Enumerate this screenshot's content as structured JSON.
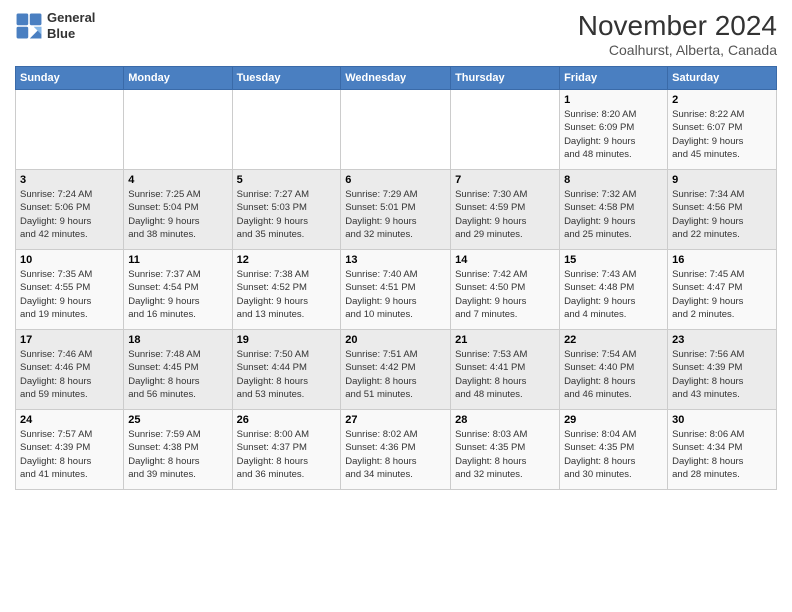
{
  "logo": {
    "line1": "General",
    "line2": "Blue"
  },
  "title": "November 2024",
  "subtitle": "Coalhurst, Alberta, Canada",
  "days_of_week": [
    "Sunday",
    "Monday",
    "Tuesday",
    "Wednesday",
    "Thursday",
    "Friday",
    "Saturday"
  ],
  "weeks": [
    [
      {
        "day": "",
        "info": ""
      },
      {
        "day": "",
        "info": ""
      },
      {
        "day": "",
        "info": ""
      },
      {
        "day": "",
        "info": ""
      },
      {
        "day": "",
        "info": ""
      },
      {
        "day": "1",
        "info": "Sunrise: 8:20 AM\nSunset: 6:09 PM\nDaylight: 9 hours\nand 48 minutes."
      },
      {
        "day": "2",
        "info": "Sunrise: 8:22 AM\nSunset: 6:07 PM\nDaylight: 9 hours\nand 45 minutes."
      }
    ],
    [
      {
        "day": "3",
        "info": "Sunrise: 7:24 AM\nSunset: 5:06 PM\nDaylight: 9 hours\nand 42 minutes."
      },
      {
        "day": "4",
        "info": "Sunrise: 7:25 AM\nSunset: 5:04 PM\nDaylight: 9 hours\nand 38 minutes."
      },
      {
        "day": "5",
        "info": "Sunrise: 7:27 AM\nSunset: 5:03 PM\nDaylight: 9 hours\nand 35 minutes."
      },
      {
        "day": "6",
        "info": "Sunrise: 7:29 AM\nSunset: 5:01 PM\nDaylight: 9 hours\nand 32 minutes."
      },
      {
        "day": "7",
        "info": "Sunrise: 7:30 AM\nSunset: 4:59 PM\nDaylight: 9 hours\nand 29 minutes."
      },
      {
        "day": "8",
        "info": "Sunrise: 7:32 AM\nSunset: 4:58 PM\nDaylight: 9 hours\nand 25 minutes."
      },
      {
        "day": "9",
        "info": "Sunrise: 7:34 AM\nSunset: 4:56 PM\nDaylight: 9 hours\nand 22 minutes."
      }
    ],
    [
      {
        "day": "10",
        "info": "Sunrise: 7:35 AM\nSunset: 4:55 PM\nDaylight: 9 hours\nand 19 minutes."
      },
      {
        "day": "11",
        "info": "Sunrise: 7:37 AM\nSunset: 4:54 PM\nDaylight: 9 hours\nand 16 minutes."
      },
      {
        "day": "12",
        "info": "Sunrise: 7:38 AM\nSunset: 4:52 PM\nDaylight: 9 hours\nand 13 minutes."
      },
      {
        "day": "13",
        "info": "Sunrise: 7:40 AM\nSunset: 4:51 PM\nDaylight: 9 hours\nand 10 minutes."
      },
      {
        "day": "14",
        "info": "Sunrise: 7:42 AM\nSunset: 4:50 PM\nDaylight: 9 hours\nand 7 minutes."
      },
      {
        "day": "15",
        "info": "Sunrise: 7:43 AM\nSunset: 4:48 PM\nDaylight: 9 hours\nand 4 minutes."
      },
      {
        "day": "16",
        "info": "Sunrise: 7:45 AM\nSunset: 4:47 PM\nDaylight: 9 hours\nand 2 minutes."
      }
    ],
    [
      {
        "day": "17",
        "info": "Sunrise: 7:46 AM\nSunset: 4:46 PM\nDaylight: 8 hours\nand 59 minutes."
      },
      {
        "day": "18",
        "info": "Sunrise: 7:48 AM\nSunset: 4:45 PM\nDaylight: 8 hours\nand 56 minutes."
      },
      {
        "day": "19",
        "info": "Sunrise: 7:50 AM\nSunset: 4:44 PM\nDaylight: 8 hours\nand 53 minutes."
      },
      {
        "day": "20",
        "info": "Sunrise: 7:51 AM\nSunset: 4:42 PM\nDaylight: 8 hours\nand 51 minutes."
      },
      {
        "day": "21",
        "info": "Sunrise: 7:53 AM\nSunset: 4:41 PM\nDaylight: 8 hours\nand 48 minutes."
      },
      {
        "day": "22",
        "info": "Sunrise: 7:54 AM\nSunset: 4:40 PM\nDaylight: 8 hours\nand 46 minutes."
      },
      {
        "day": "23",
        "info": "Sunrise: 7:56 AM\nSunset: 4:39 PM\nDaylight: 8 hours\nand 43 minutes."
      }
    ],
    [
      {
        "day": "24",
        "info": "Sunrise: 7:57 AM\nSunset: 4:39 PM\nDaylight: 8 hours\nand 41 minutes."
      },
      {
        "day": "25",
        "info": "Sunrise: 7:59 AM\nSunset: 4:38 PM\nDaylight: 8 hours\nand 39 minutes."
      },
      {
        "day": "26",
        "info": "Sunrise: 8:00 AM\nSunset: 4:37 PM\nDaylight: 8 hours\nand 36 minutes."
      },
      {
        "day": "27",
        "info": "Sunrise: 8:02 AM\nSunset: 4:36 PM\nDaylight: 8 hours\nand 34 minutes."
      },
      {
        "day": "28",
        "info": "Sunrise: 8:03 AM\nSunset: 4:35 PM\nDaylight: 8 hours\nand 32 minutes."
      },
      {
        "day": "29",
        "info": "Sunrise: 8:04 AM\nSunset: 4:35 PM\nDaylight: 8 hours\nand 30 minutes."
      },
      {
        "day": "30",
        "info": "Sunrise: 8:06 AM\nSunset: 4:34 PM\nDaylight: 8 hours\nand 28 minutes."
      }
    ]
  ]
}
